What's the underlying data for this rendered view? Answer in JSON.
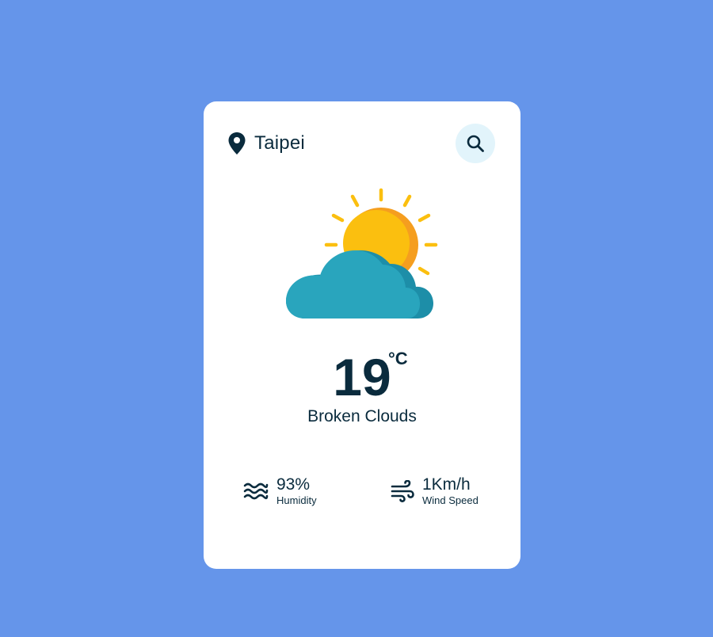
{
  "colors": {
    "background": "#6595ea",
    "card": "#ffffff",
    "text": "#0a2b3d",
    "search_button_bg": "#e2f4fb",
    "sun": "#fbbf0f",
    "sun_shade": "#f59e1f",
    "cloud": "#29a5bd",
    "cloud_shade": "#1d8ea8"
  },
  "location": {
    "icon": "map-pin-icon",
    "city": "Taipei"
  },
  "search": {
    "icon": "search-icon"
  },
  "weather": {
    "icon": "partly-cloudy-icon",
    "temperature": "19",
    "unit": "°C",
    "description": "Broken Clouds"
  },
  "stats": {
    "humidity": {
      "icon": "waves-icon",
      "value": "93%",
      "label": "Humidity"
    },
    "wind": {
      "icon": "wind-icon",
      "value": "1Km/h",
      "label": "Wind Speed"
    }
  }
}
